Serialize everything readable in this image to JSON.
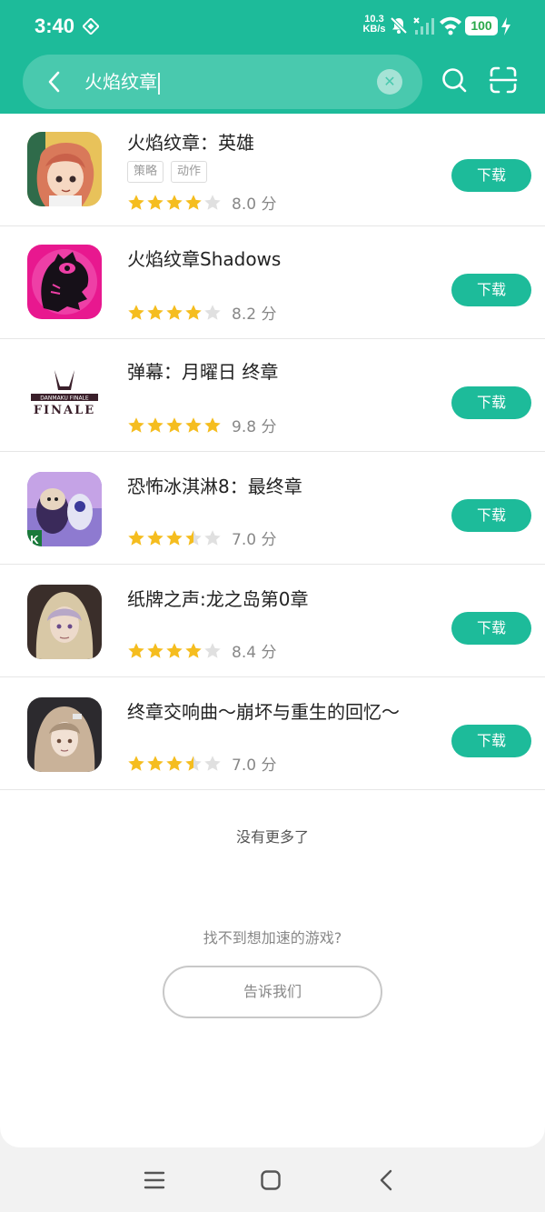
{
  "status": {
    "time": "3:40",
    "net_speed_value": "10.3",
    "net_speed_unit": "KB/s",
    "battery": "100"
  },
  "search": {
    "query": "火焰纹章"
  },
  "results": [
    {
      "name": "火焰纹章：英雄",
      "tags": [
        "策略",
        "动作"
      ],
      "stars": 4,
      "score": "8.0 分",
      "download": "下载"
    },
    {
      "name": "火焰纹章Shadows",
      "tags": [],
      "stars": 4,
      "score": "8.2 分",
      "download": "下载"
    },
    {
      "name": "弹幕：月曜日 终章",
      "tags": [],
      "stars": 5,
      "score": "9.8 分",
      "download": "下载"
    },
    {
      "name": "恐怖冰淇淋8：最终章",
      "tags": [],
      "stars": 3.5,
      "score": "7.0 分",
      "download": "下载"
    },
    {
      "name": "纸牌之声:龙之岛第0章",
      "tags": [],
      "stars": 4,
      "score": "8.4 分",
      "download": "下载"
    },
    {
      "name": "终章交响曲～崩坏与重生的回忆～",
      "tags": [],
      "stars": 3.5,
      "score": "7.0 分",
      "download": "下载"
    }
  ],
  "footer": {
    "no_more": "没有更多了",
    "cant_find": "找不到想加速的游戏?",
    "tell_us": "告诉我们"
  },
  "icons": {
    "app_icon_3_text": "DANMAKU FINALE",
    "app_icon_4_badge": "K"
  },
  "colors": {
    "accent": "#1dbb9a",
    "star": "#f5bd1f",
    "star_empty": "#e0e0e0"
  }
}
